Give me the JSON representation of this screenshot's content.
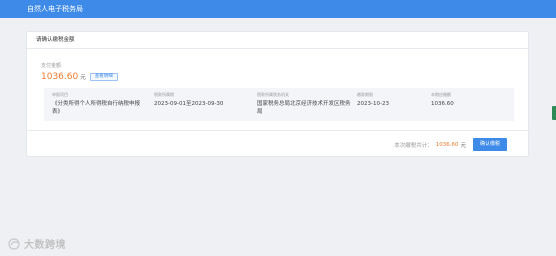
{
  "app": {
    "title": "自然人电子税务局"
  },
  "card": {
    "header": "请确认缴税金额",
    "pay_label": "支付金额",
    "pay_amount": "1036.60",
    "pay_unit": "元",
    "detail_button": "查看明细"
  },
  "table": {
    "columns": [
      "申报项目",
      "税款所属期",
      "税款所属税务机关",
      "缴款期限",
      "本期应缴额"
    ],
    "row": [
      "《分类所得个人所得税自行纳税申报表》",
      "2023-09-01至2023-09-30",
      "国家税务总局北京经济技术开发区税务局",
      "2023-10-23",
      "1036.60"
    ]
  },
  "summary": {
    "label": "本次缴税共计：",
    "amount": "1036.60",
    "unit": "元",
    "confirm_button": "确认缴税"
  },
  "watermark": {
    "text": "大数跨境"
  },
  "colors": {
    "brand": "#3d8ae8",
    "amount": "#f07a2e"
  }
}
